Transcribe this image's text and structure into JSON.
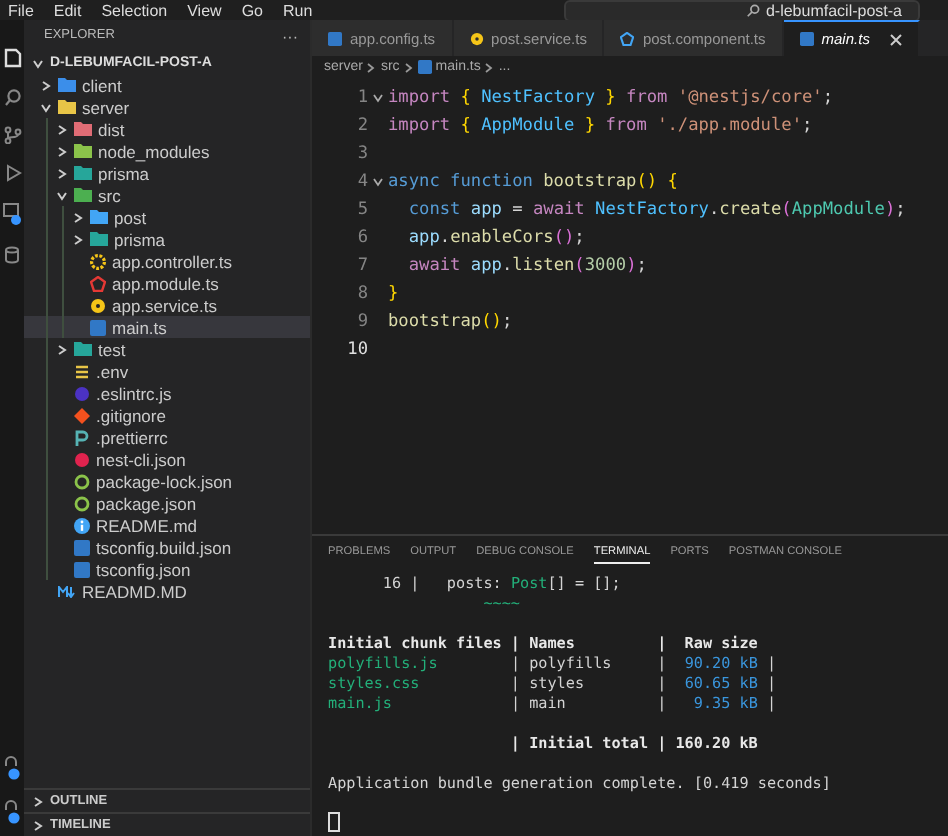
{
  "menu_bar": {
    "items": [
      "File",
      "Edit",
      "Selection",
      "View",
      "Go",
      "Run"
    ],
    "search": "d-lebumfacil-post-a"
  },
  "explorer": {
    "title": "EXPLORER",
    "more": "···",
    "project": {
      "name": "D-LEBUMFACIL-POST-A",
      "expanded": true,
      "children": [
        {
          "name": "client",
          "kind": "folder",
          "color": "#3b8eea",
          "expanded": false,
          "selected": false
        },
        {
          "name": "server",
          "kind": "folder",
          "color": "#e8c547",
          "expanded": true,
          "selected": false,
          "children": [
            {
              "name": "dist",
              "kind": "folder",
              "color": "#e06c75",
              "expanded": false,
              "selected": false
            },
            {
              "name": "node_modules",
              "kind": "folder",
              "color": "#8bc34a",
              "expanded": false,
              "selected": false
            },
            {
              "name": "prisma",
              "kind": "folder",
              "color": "#26a69a",
              "expanded": false,
              "selected": false
            },
            {
              "name": "src",
              "kind": "folder",
              "color": "#4caf50",
              "expanded": true,
              "selected": false,
              "children": [
                {
                  "name": "post",
                  "kind": "folder",
                  "color": "#42a5f5",
                  "expanded": false,
                  "selected": false
                },
                {
                  "name": "prisma",
                  "kind": "folder",
                  "color": "#26a69a",
                  "expanded": false,
                  "selected": false
                },
                {
                  "name": "app.controller.ts",
                  "kind": "gear",
                  "color": "#f5c518",
                  "selected": false
                },
                {
                  "name": "app.module.ts",
                  "kind": "module",
                  "color": "#e53935",
                  "selected": false
                },
                {
                  "name": "app.service.ts",
                  "kind": "service",
                  "color": "#f5c518",
                  "selected": false
                },
                {
                  "name": "main.ts",
                  "kind": "ts",
                  "color": "#3178c6",
                  "selected": true
                }
              ]
            },
            {
              "name": "test",
              "kind": "folder",
              "color": "#26a69a",
              "expanded": false,
              "selected": false
            },
            {
              "name": ".env",
              "kind": "env",
              "color": "#e8c547",
              "selected": false
            },
            {
              "name": ".eslintrc.js",
              "kind": "dot",
              "color": "#4b32c3",
              "selected": false
            },
            {
              "name": ".gitignore",
              "kind": "diamond",
              "color": "#f4511e",
              "selected": false
            },
            {
              "name": ".prettierrc",
              "kind": "prettier",
              "color": "#56b3b4",
              "selected": false
            },
            {
              "name": "nest-cli.json",
              "kind": "dot",
              "color": "#e0234e",
              "selected": false
            },
            {
              "name": "package-lock.json",
              "kind": "ring",
              "color": "#8bc34a",
              "selected": false
            },
            {
              "name": "package.json",
              "kind": "ring",
              "color": "#8bc34a",
              "selected": false
            },
            {
              "name": "README.md",
              "kind": "info",
              "color": "#42a5f5",
              "selected": false
            },
            {
              "name": "tsconfig.build.json",
              "kind": "ts",
              "color": "#3178c6",
              "selected": false
            },
            {
              "name": "tsconfig.json",
              "kind": "ts",
              "color": "#3178c6",
              "selected": false
            }
          ]
        },
        {
          "name": "READMD.MD",
          "kind": "markdown",
          "color": "#42a5f5",
          "selected": false
        }
      ]
    },
    "sections": [
      {
        "title": "OUTLINE",
        "expanded": false
      },
      {
        "title": "TIMELINE",
        "expanded": false
      }
    ]
  },
  "editor": {
    "tabs": [
      {
        "label": "app.config.ts",
        "kind": "ts",
        "color": "#3178c6",
        "selected": false
      },
      {
        "label": "post.service.ts",
        "kind": "service",
        "color": "#f5c518",
        "selected": false
      },
      {
        "label": "post.component.ts",
        "kind": "module",
        "color": "#42a5f5",
        "selected": false
      },
      {
        "label": "main.ts",
        "kind": "ts",
        "color": "#3178c6",
        "selected": true
      }
    ],
    "breadcrumbs": [
      {
        "label": "server",
        "kind": "folder"
      },
      {
        "label": "src",
        "kind": "folder"
      },
      {
        "label": "main.ts",
        "kind": "ts"
      },
      {
        "label": "...",
        "kind": "more"
      }
    ],
    "lines": [
      {
        "number": "1",
        "foldable": true,
        "current": false,
        "tokens": [
          {
            "text": "import ",
            "kind": "ctrl"
          },
          {
            "text": "{",
            "kind": "brace"
          },
          {
            "text": " NestFactory ",
            "kind": "cls"
          },
          {
            "text": "}",
            "kind": "brace"
          },
          {
            "text": " from ",
            "kind": "ctrl"
          },
          {
            "text": "'@nestjs/core'",
            "kind": "str"
          },
          {
            "text": ";",
            "kind": "plain"
          }
        ]
      },
      {
        "number": "2",
        "foldable": false,
        "current": false,
        "tokens": [
          {
            "text": "import ",
            "kind": "ctrl"
          },
          {
            "text": "{",
            "kind": "brace"
          },
          {
            "text": " AppModule ",
            "kind": "cls"
          },
          {
            "text": "}",
            "kind": "brace"
          },
          {
            "text": " from ",
            "kind": "ctrl"
          },
          {
            "text": "'./app.module'",
            "kind": "str"
          },
          {
            "text": ";",
            "kind": "plain"
          }
        ]
      },
      {
        "number": "3",
        "foldable": false,
        "current": false
      },
      {
        "number": "4",
        "foldable": true,
        "current": false,
        "tokens": [
          {
            "text": "async function ",
            "kind": "kw"
          },
          {
            "text": "bootstrap",
            "kind": "fn"
          },
          {
            "text": "() {",
            "kind": "brace"
          }
        ]
      },
      {
        "number": "5",
        "foldable": false,
        "current": false,
        "tokens": [
          {
            "text": "  const ",
            "kind": "kw"
          },
          {
            "text": "app",
            "kind": "var"
          },
          {
            "text": " = ",
            "kind": "plain"
          },
          {
            "text": "await ",
            "kind": "ctrl"
          },
          {
            "text": "NestFactory",
            "kind": "cls"
          },
          {
            "text": ".",
            "kind": "plain"
          },
          {
            "text": "create",
            "kind": "fn"
          },
          {
            "text": "(",
            "kind": "paren"
          },
          {
            "text": "AppModule",
            "kind": "type"
          },
          {
            "text": ")",
            "kind": "paren"
          },
          {
            "text": ";",
            "kind": "plain"
          }
        ]
      },
      {
        "number": "6",
        "foldable": false,
        "current": false,
        "tokens": [
          {
            "text": "  app",
            "kind": "var"
          },
          {
            "text": ".",
            "kind": "plain"
          },
          {
            "text": "enableCors",
            "kind": "fn"
          },
          {
            "text": "()",
            "kind": "paren"
          },
          {
            "text": ";",
            "kind": "plain"
          }
        ]
      },
      {
        "number": "7",
        "foldable": false,
        "current": false,
        "tokens": [
          {
            "text": "  await ",
            "kind": "ctrl"
          },
          {
            "text": "app",
            "kind": "var"
          },
          {
            "text": ".",
            "kind": "plain"
          },
          {
            "text": "listen",
            "kind": "fn"
          },
          {
            "text": "(",
            "kind": "paren"
          },
          {
            "text": "3000",
            "kind": "num"
          },
          {
            "text": ")",
            "kind": "paren"
          },
          {
            "text": ";",
            "kind": "plain"
          }
        ]
      },
      {
        "number": "8",
        "foldable": false,
        "current": false,
        "tokens": [
          {
            "text": "}",
            "kind": "brace"
          }
        ]
      },
      {
        "number": "9",
        "foldable": false,
        "current": false,
        "tokens": [
          {
            "text": "bootstrap",
            "kind": "fn"
          },
          {
            "text": "()",
            "kind": "brace"
          },
          {
            "text": ";",
            "kind": "plain"
          }
        ]
      },
      {
        "number": "10",
        "foldable": false,
        "current": true
      }
    ]
  },
  "panel": {
    "tabs": [
      {
        "label": "PROBLEMS",
        "selected": false
      },
      {
        "label": "OUTPUT",
        "selected": false
      },
      {
        "label": "DEBUG CONSOLE",
        "selected": false
      },
      {
        "label": "TERMINAL",
        "selected": true
      },
      {
        "label": "PORTS",
        "selected": false
      },
      {
        "label": "POSTMAN CONSOLE",
        "selected": false
      }
    ],
    "terminal": [
      {
        "gap_before": false,
        "tokens": [
          {
            "text": "      16 |   posts: ",
            "kind": "plain"
          },
          {
            "text": "Post",
            "kind": "green"
          },
          {
            "text": "[] = [];",
            "kind": "plain"
          }
        ]
      },
      {
        "gap_before": false,
        "tokens": [
          {
            "text": "                 ~~~~",
            "kind": "green"
          }
        ]
      },
      {
        "gap_before": true,
        "tokens": [
          {
            "text": "Initial chunk files | Names         |  Raw size",
            "kind": "bold"
          }
        ]
      },
      {
        "gap_before": false,
        "tokens": [
          {
            "text": "polyfills.js",
            "kind": "green"
          },
          {
            "text": "        | polyfills     |  ",
            "kind": "plain"
          },
          {
            "text": "90.20 kB",
            "kind": "cyan"
          },
          {
            "text": " |",
            "kind": "plain"
          }
        ]
      },
      {
        "gap_before": false,
        "tokens": [
          {
            "text": "styles.css",
            "kind": "green"
          },
          {
            "text": "          | styles        |  ",
            "kind": "plain"
          },
          {
            "text": "60.65 kB",
            "kind": "cyan"
          },
          {
            "text": " |",
            "kind": "plain"
          }
        ]
      },
      {
        "gap_before": false,
        "tokens": [
          {
            "text": "main.js",
            "kind": "green"
          },
          {
            "text": "             | main          |   ",
            "kind": "plain"
          },
          {
            "text": "9.35 kB",
            "kind": "cyan"
          },
          {
            "text": " |",
            "kind": "plain"
          }
        ]
      },
      {
        "gap_before": true,
        "tokens": [
          {
            "text": "                    | Initial total | 160.20 kB",
            "kind": "bold"
          }
        ]
      },
      {
        "gap_before": true,
        "tokens": [
          {
            "text": "Application bundle generation complete. [0.419 seconds]",
            "kind": "plain"
          }
        ]
      }
    ],
    "cursor": true
  }
}
